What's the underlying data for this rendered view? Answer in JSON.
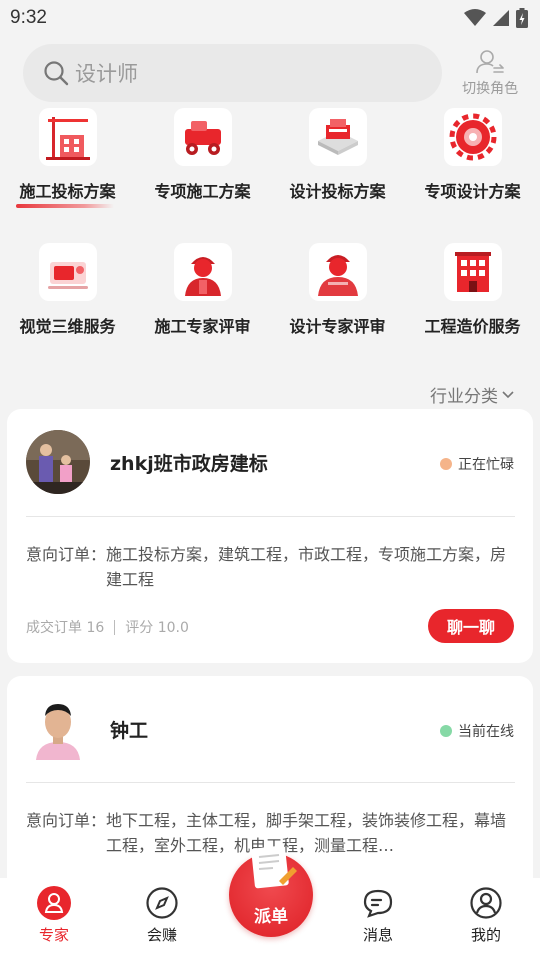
{
  "status_bar": {
    "time": "9:32"
  },
  "search": {
    "placeholder": "设计师"
  },
  "role_switch": {
    "label": "切换角色"
  },
  "categories": [
    {
      "label": "施工投标方案",
      "icon": "construction-crane-icon",
      "active": true
    },
    {
      "label": "专项施工方案",
      "icon": "construction-machine-icon"
    },
    {
      "label": "设计投标方案",
      "icon": "building-model-icon"
    },
    {
      "label": "专项设计方案",
      "icon": "gear-design-icon"
    },
    {
      "label": "视觉三维服务",
      "icon": "3d-visual-icon"
    },
    {
      "label": "施工专家评审",
      "icon": "construction-expert-icon"
    },
    {
      "label": "设计专家评审",
      "icon": "design-expert-icon"
    },
    {
      "label": "工程造价服务",
      "icon": "cost-building-icon"
    }
  ],
  "filter": {
    "label": "行业分类"
  },
  "experts": [
    {
      "name": "zhkj班市政房建标",
      "status": "正在忙碌",
      "status_color": "#f5b48a",
      "intent_label": "意向订单：",
      "intent": "施工投标方案，建筑工程，市政工程，专项施工方案，房建工程",
      "deals": "成交订单 16",
      "rating": "评分 10.0",
      "chat_label": "聊一聊"
    },
    {
      "name": "钟工",
      "status": "当前在线",
      "status_color": "#86d9a6",
      "intent_label": "意向订单：",
      "intent": "地下工程，主体工程，脚手架工程，装饰装修工程，幕墙工程，室外工程，机电工程，测量工程…"
    }
  ],
  "tabbar": {
    "items": [
      {
        "label": "专家",
        "icon": "expert-icon",
        "active": true
      },
      {
        "label": "会赚",
        "icon": "compass-icon"
      },
      {
        "label": "消息",
        "icon": "message-icon"
      },
      {
        "label": "我的",
        "icon": "profile-icon"
      }
    ],
    "dispatch_label": "派单"
  },
  "colors": {
    "accent": "#e8262c",
    "background": "#f3f3f3"
  }
}
